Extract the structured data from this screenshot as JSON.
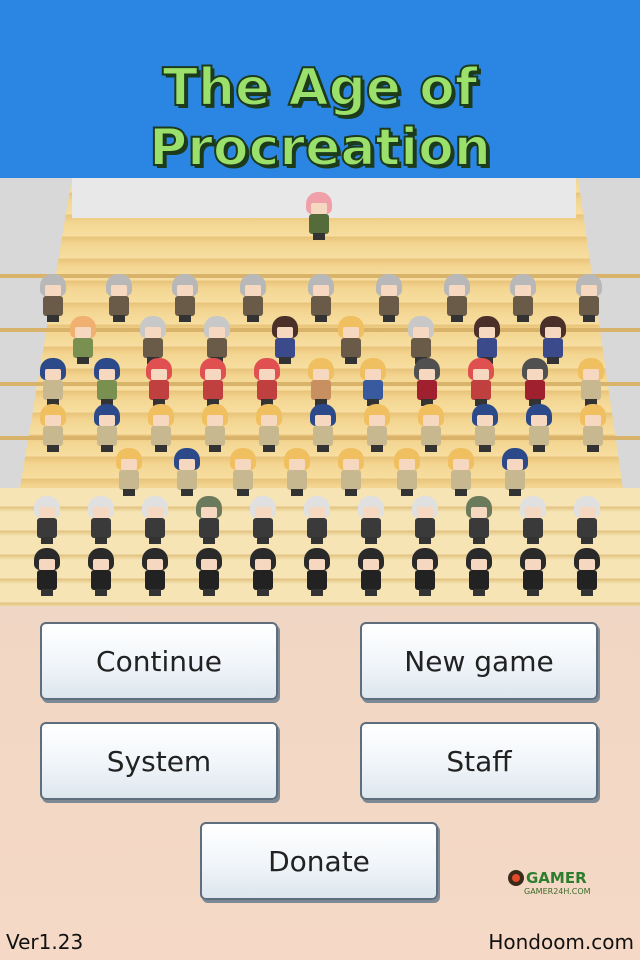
{
  "title": "The Age of Procreation",
  "buttons": {
    "continue": "Continue",
    "new_game": "New game",
    "system": "System",
    "staff": "Staff",
    "donate": "Donate"
  },
  "badge": {
    "brand": "GAMER",
    "sub": "GAMER24H.COM"
  },
  "footer": {
    "version": "Ver1.23",
    "site": "Hondoom.com"
  }
}
